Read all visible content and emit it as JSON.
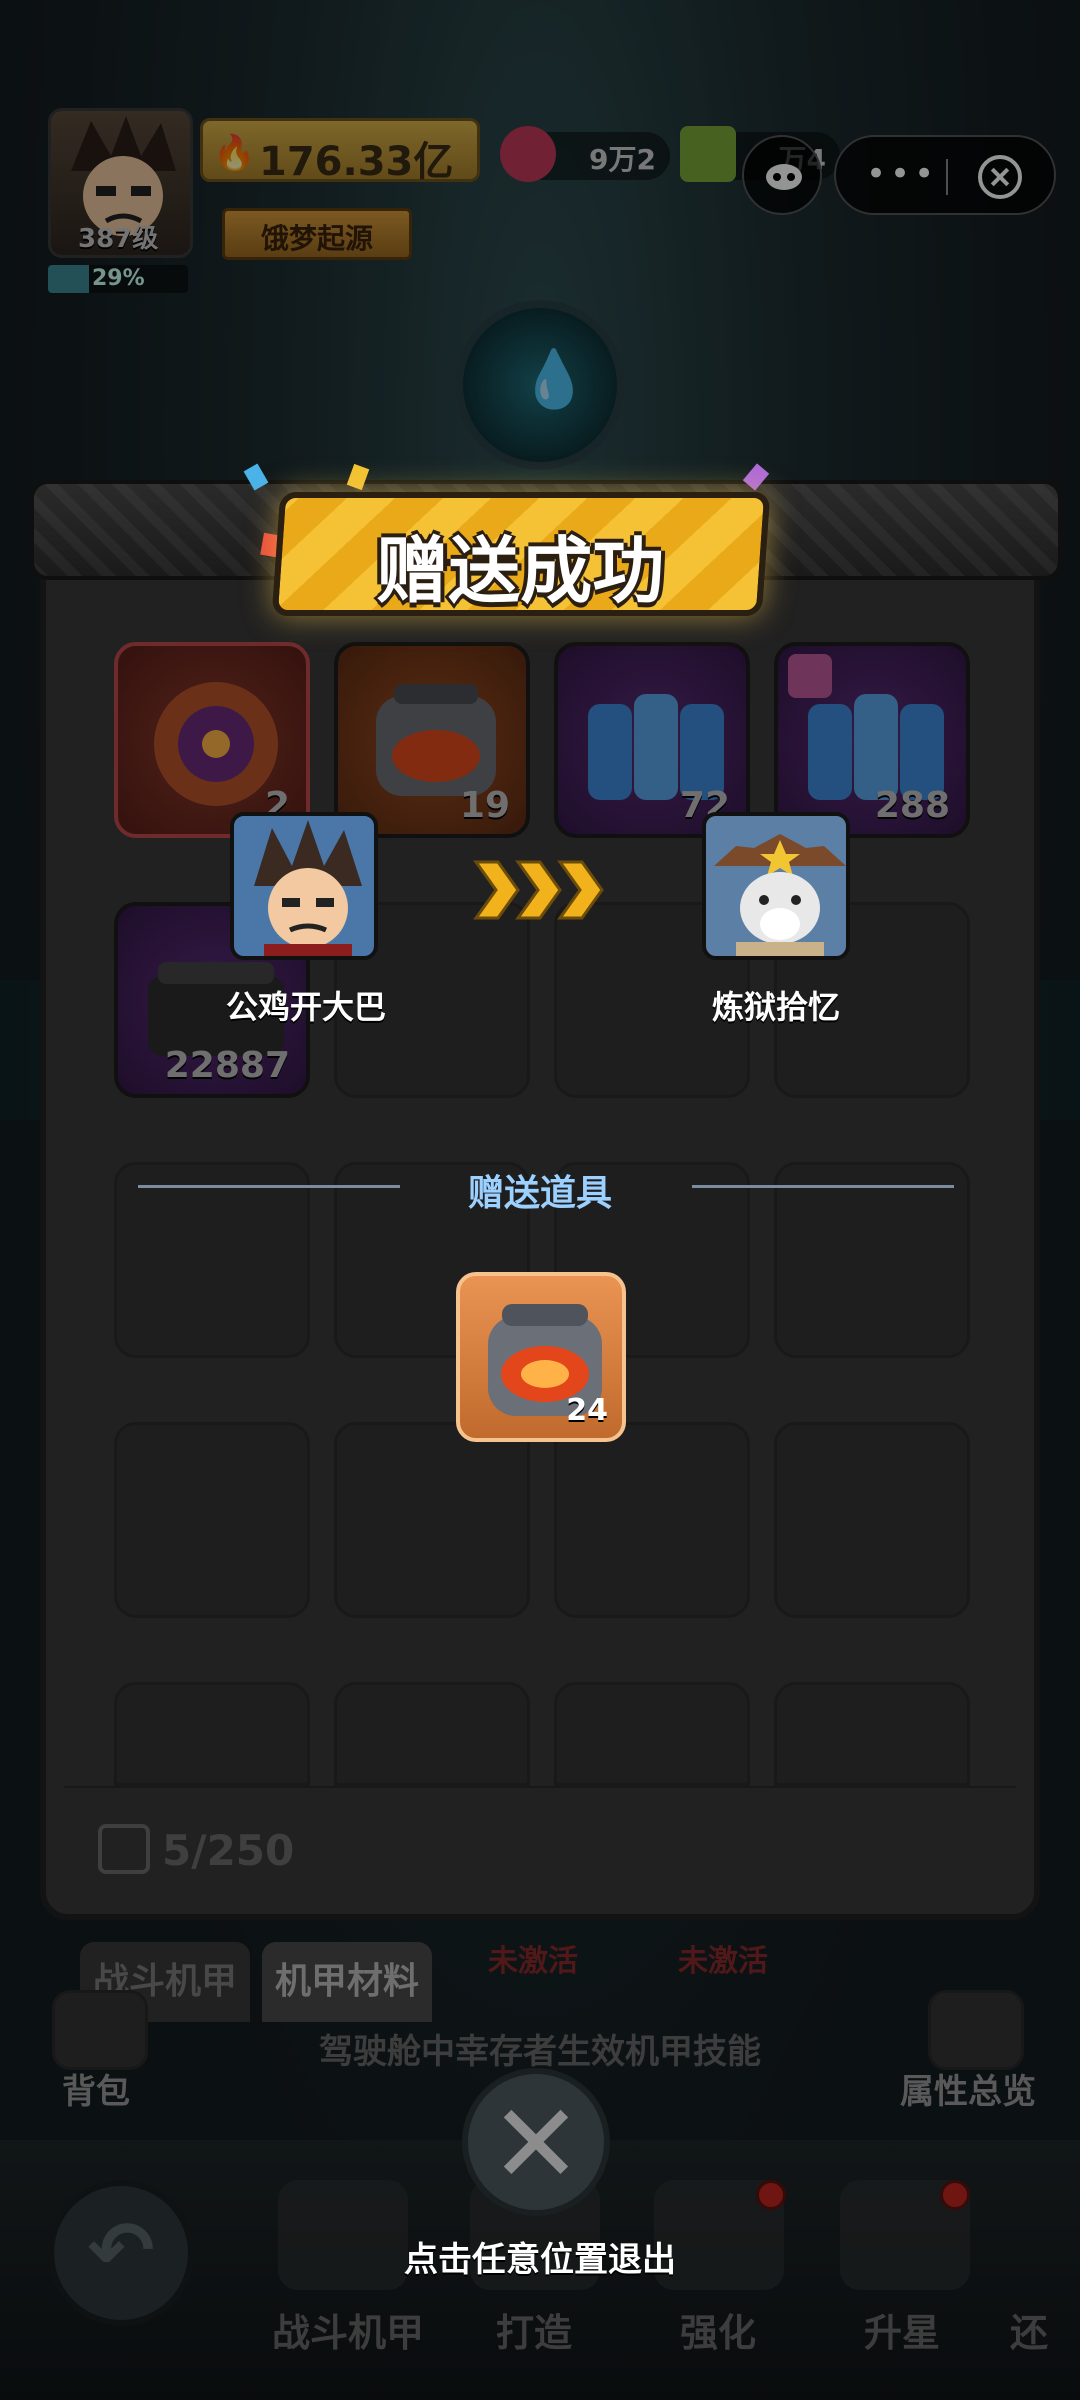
{
  "hud": {
    "level": "387级",
    "xp_percent_text": "29%",
    "xp_fraction": 0.29,
    "power": "176.33亿",
    "resource_gems": "9万2",
    "resource_cash": "万4",
    "title": "饿梦起源"
  },
  "dialog": {
    "title": "赠送成功",
    "sender_name": "公鸡开大巴",
    "receiver_name": "炼狱拾忆",
    "gift_label": "赠送道具",
    "gift_item": {
      "icon": "reactor-core-icon",
      "count": "24"
    }
  },
  "inventory": {
    "items": [
      {
        "icon": "fire-orb-icon",
        "count": "2",
        "rarity_color": "#c0392b"
      },
      {
        "icon": "reactor-core-icon",
        "count": "19",
        "rarity_color": "#d35400"
      },
      {
        "icon": "battery-pack-icon",
        "count": "72",
        "rarity_color": "#7d3c98"
      },
      {
        "icon": "battery-pack-gift-icon",
        "count": "288",
        "rarity_color": "#7d3c98"
      },
      {
        "icon": "armor-plate-icon",
        "count": "22887",
        "rarity_color": "#7d3c98"
      }
    ],
    "capacity": "5/250"
  },
  "tabs": {
    "combat_mech": "战斗机甲",
    "mech_material": "机甲材料",
    "inactive_1": "未激活",
    "inactive_2": "未激活"
  },
  "skill_note": "驾驶舱中幸存者生效机甲技能",
  "side_buttons": {
    "bag": "背包",
    "attributes": "属性总览"
  },
  "nav": {
    "items": [
      "战斗机甲",
      "打造",
      "强化",
      "升星",
      "还"
    ]
  },
  "exit_hint": "点击任意位置退出",
  "colors": {
    "accent": "#f5c236",
    "gift_label": "#9bd0ff",
    "panel": "#3a3a3a"
  }
}
